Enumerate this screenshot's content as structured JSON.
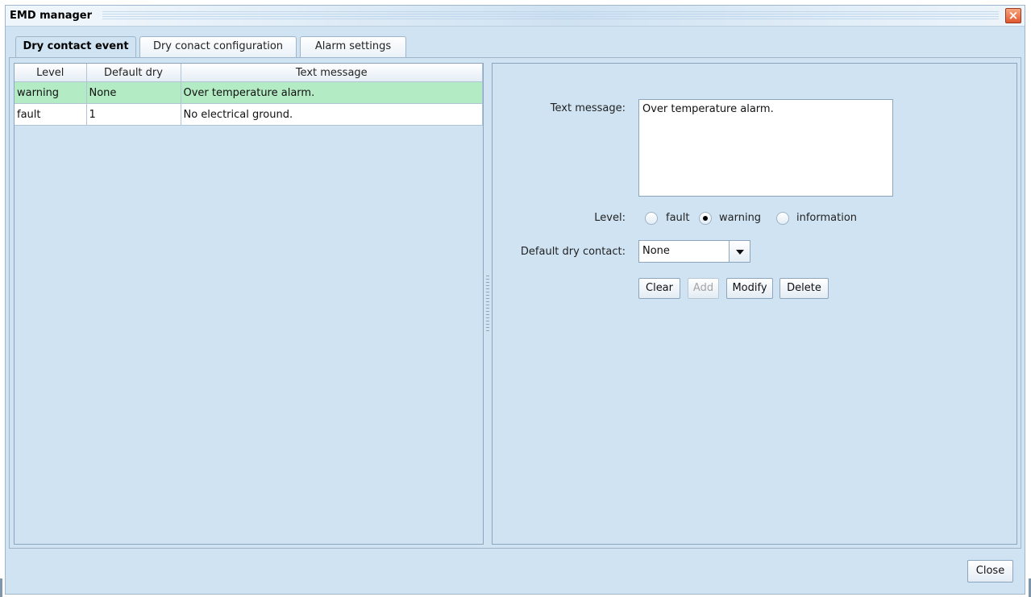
{
  "window": {
    "title": "EMD manager",
    "close_icon": "close-x-icon"
  },
  "tabs": [
    {
      "label": "Dry contact event",
      "active": true
    },
    {
      "label": "Dry conact configuration",
      "active": false
    },
    {
      "label": "Alarm settings",
      "active": false
    }
  ],
  "table": {
    "columns": [
      "Level",
      "Default dry",
      "Text message"
    ],
    "rows": [
      {
        "level": "warning",
        "default_dry": "None",
        "text": "Over temperature alarm.",
        "selected": true
      },
      {
        "level": "fault",
        "default_dry": "1",
        "text": "No electrical ground.",
        "selected": false
      }
    ]
  },
  "form": {
    "text_message_label": "Text message:",
    "text_message_value": "Over temperature alarm.",
    "level_label": "Level:",
    "level_options": [
      "fault",
      "warning",
      "information"
    ],
    "level_selected": "warning",
    "default_dry_label": "Default dry contact:",
    "default_dry_value": "None",
    "buttons": {
      "clear": "Clear",
      "add": "Add",
      "modify": "Modify",
      "delete": "Delete"
    }
  },
  "footer": {
    "close_label": "Close"
  },
  "colors": {
    "background": "#cfe3f3",
    "selected_row": "#b3ebc5",
    "close_x": "#e0582d"
  }
}
